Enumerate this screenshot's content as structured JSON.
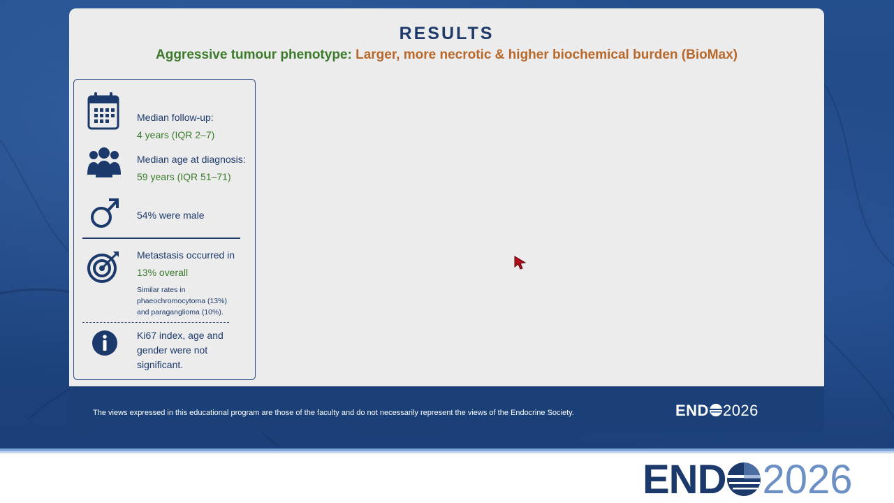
{
  "slide": {
    "title": "RESULTS",
    "subtitle_lead": "Aggressive tumour phenotype:",
    "subtitle_rest": "Larger, more necrotic & higher biochemical burden (BioMax)"
  },
  "stats": {
    "followup_label": "Median follow-up:",
    "followup_value": "4 years (IQR 2–7)",
    "age_label": "Median age at diagnosis:",
    "age_value": "59 years (IQR 51–71)",
    "male": "54% were male",
    "metastasis_label": "Metastasis occurred in",
    "metastasis_value": "13% overall",
    "metastasis_note1": "Similar rates in",
    "metastasis_note2": "phaeochromocytoma (13%)",
    "metastasis_note3": "and paraganglioma (10%).",
    "ki67_line1": "Ki67 index, age and",
    "ki67_line2": "gender were not",
    "ki67_line3": "significant."
  },
  "footer": {
    "disclaimer": "The views expressed in this educational program are those of the faculty and do not necessarily represent the views of the Endocrine Society.",
    "logo_text": "END",
    "logo_year": "2026"
  },
  "brand": {
    "logo_text": "END",
    "logo_year": "2026",
    "navy": "#1b3a6b",
    "light_blue": "#6c8fc4",
    "green": "#3b7a2a",
    "orange": "#b8672a"
  },
  "icons": [
    "calendar-icon",
    "people-icon",
    "male-symbol-icon",
    "target-icon",
    "info-icon",
    "globe-icon",
    "cursor-icon"
  ]
}
